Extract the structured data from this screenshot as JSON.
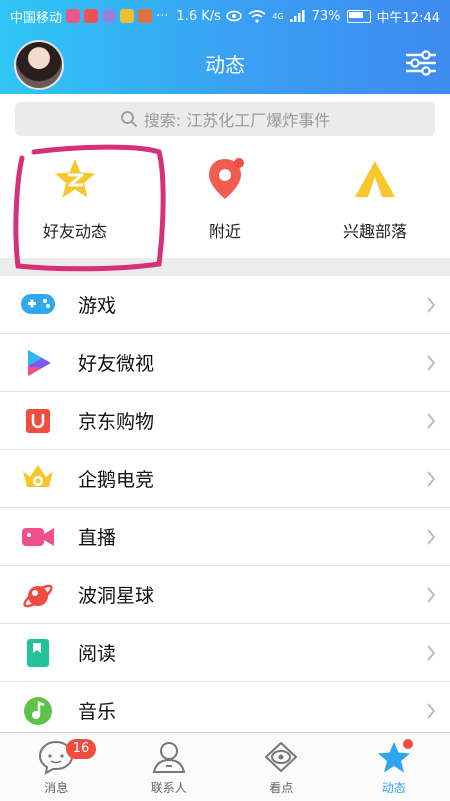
{
  "status": {
    "carrier": "中国移动",
    "speed": "1.6 K/s",
    "network": "4G",
    "battery": "73%",
    "time": "中午12:44"
  },
  "header": {
    "title": "动态"
  },
  "search": {
    "placeholder": "搜索: 江苏化工厂爆炸事件"
  },
  "quick": [
    {
      "label": "好友动态",
      "icon": "qzone-star-icon"
    },
    {
      "label": "附近",
      "icon": "location-pin-icon"
    },
    {
      "label": "兴趣部落",
      "icon": "tent-icon"
    }
  ],
  "list": [
    {
      "label": "游戏",
      "icon": "gamepad-icon"
    },
    {
      "label": "好友微视",
      "icon": "play-icon"
    },
    {
      "label": "京东购物",
      "icon": "shopping-bag-icon"
    },
    {
      "label": "企鹅电竞",
      "icon": "esports-shield-icon"
    },
    {
      "label": "直播",
      "icon": "video-camera-icon"
    },
    {
      "label": "波洞星球",
      "icon": "planet-icon"
    },
    {
      "label": "阅读",
      "icon": "book-icon"
    },
    {
      "label": "音乐",
      "icon": "music-note-icon"
    }
  ],
  "tabs": [
    {
      "label": "消息",
      "icon": "message-bubble-icon",
      "badge": "16"
    },
    {
      "label": "联系人",
      "icon": "contacts-icon"
    },
    {
      "label": "看点",
      "icon": "eye-icon"
    },
    {
      "label": "动态",
      "icon": "star-icon",
      "active": true
    }
  ],
  "colors": {
    "accent": "#2ea5f3",
    "header_start": "#2fc6f6",
    "header_end": "#3d8af1",
    "badge": "#f04c40",
    "highlight": "#d6307a"
  }
}
